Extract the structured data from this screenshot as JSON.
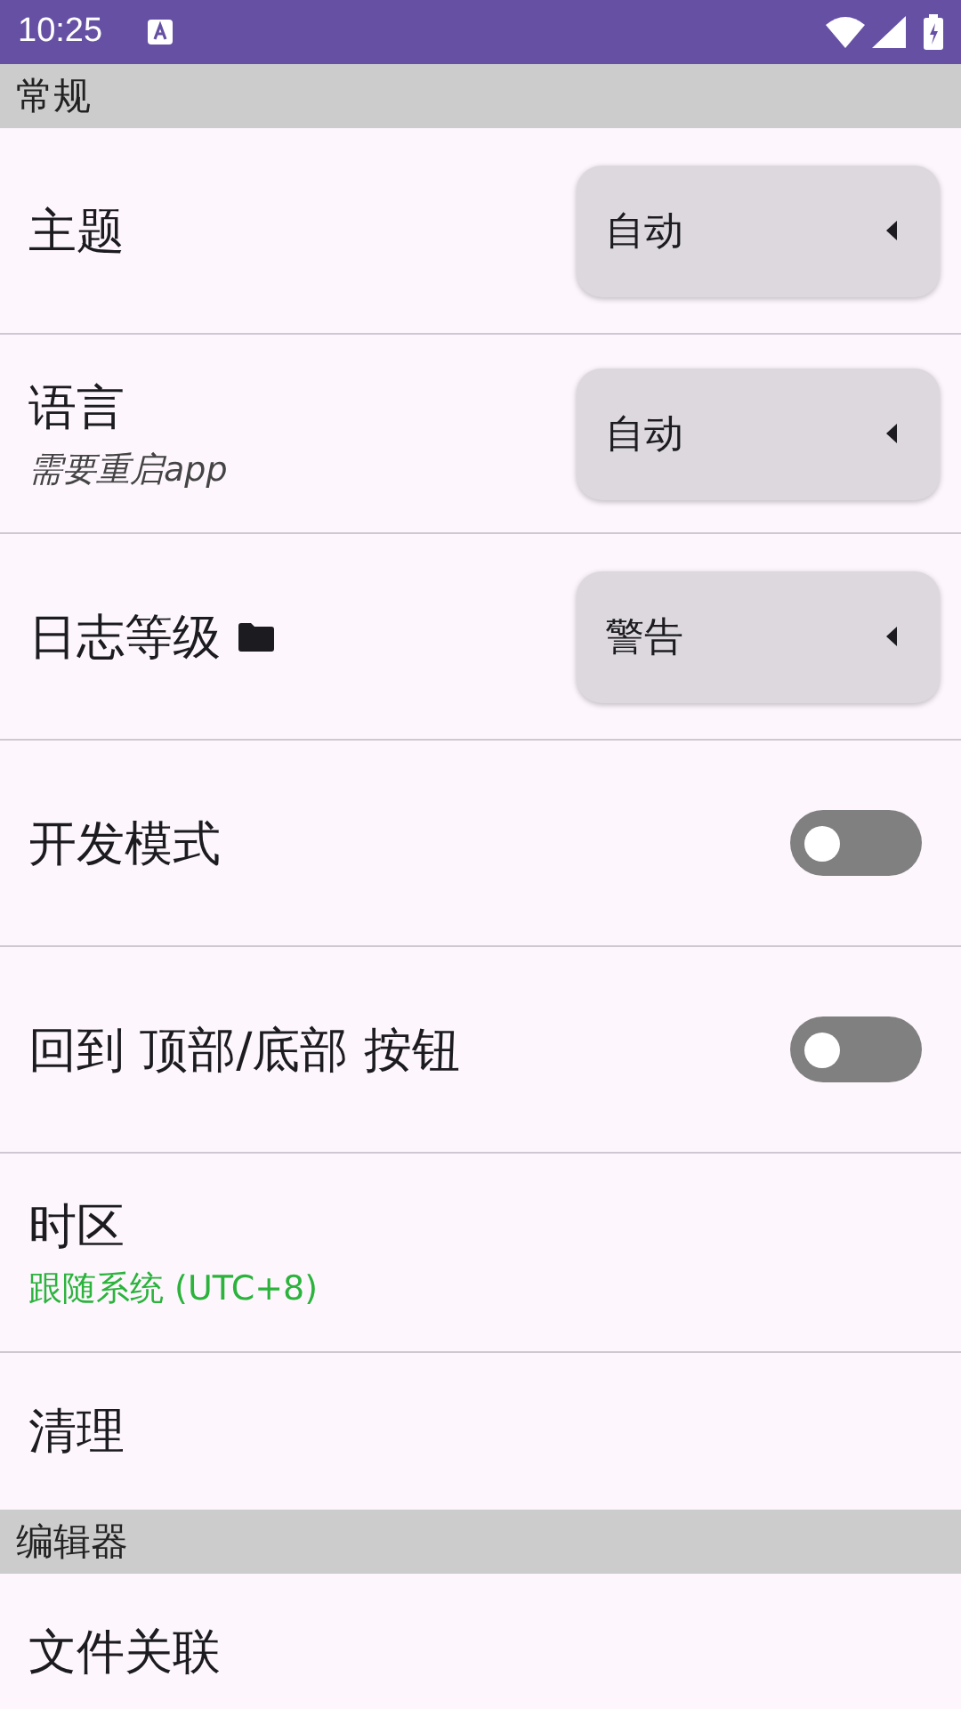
{
  "status_bar": {
    "time": "10:25"
  },
  "sections": [
    {
      "title": "常规",
      "items": [
        {
          "kind": "dropdown",
          "label": "主题",
          "value": "自动"
        },
        {
          "kind": "dropdown",
          "label": "语言",
          "subtitle": {
            "text": "需要重启app",
            "kind": "hint"
          },
          "value": "自动"
        },
        {
          "kind": "dropdown",
          "label": "日志等级",
          "folder_icon": true,
          "value": "警告"
        },
        {
          "kind": "switch",
          "label": "开发模式",
          "on": false
        },
        {
          "kind": "switch",
          "label": "回到 顶部/底部 按钮",
          "on": false
        },
        {
          "kind": "plain",
          "label": "时区",
          "subtitle": {
            "text": "跟随系统 (UTC+8)",
            "kind": "status"
          }
        },
        {
          "kind": "plain",
          "label": "清理"
        }
      ]
    },
    {
      "title": "编辑器",
      "items": [
        {
          "kind": "plain",
          "label": "文件关联"
        }
      ]
    }
  ]
}
